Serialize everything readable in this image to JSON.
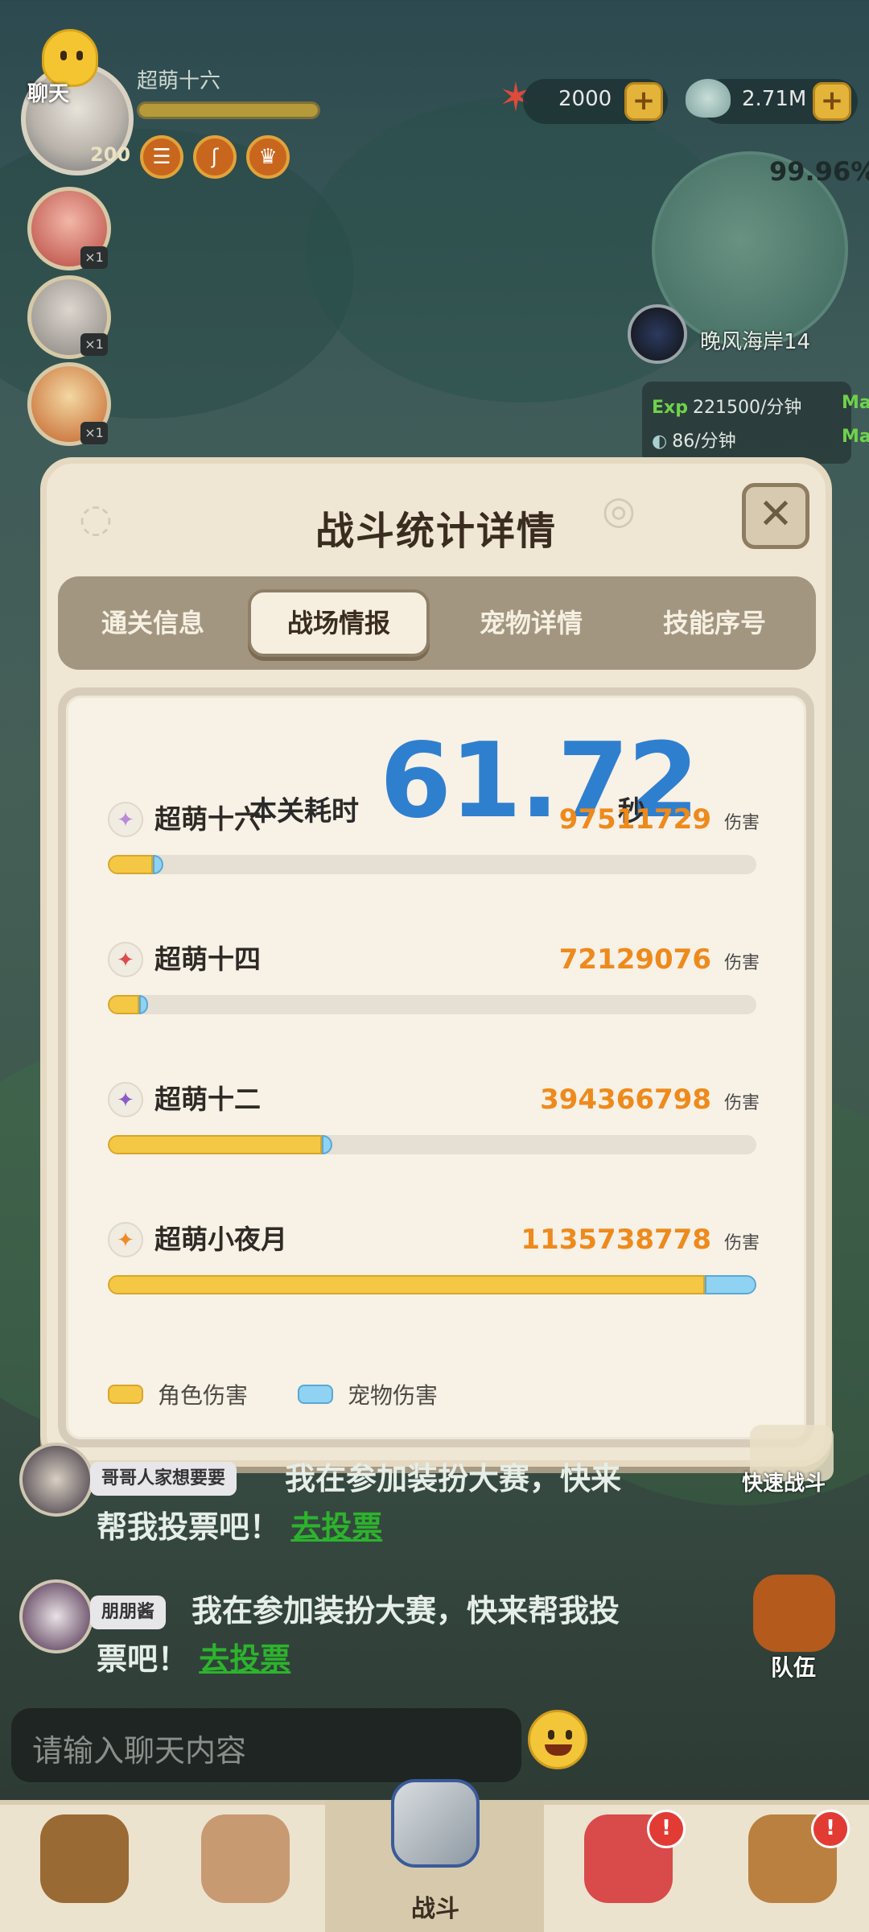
{
  "hud": {
    "chat_label": "聊天",
    "player_name": "超萌十六",
    "player_level": "200",
    "player_bar_fraction": 1.0,
    "buff_icons": [
      "hamburger-icon",
      "swirl-icon",
      "crown-icon"
    ],
    "currencies": [
      {
        "icon": "starfish-icon",
        "value": "2000"
      },
      {
        "icon": "shell-icon",
        "value": "2.71M"
      }
    ],
    "plus_label": "+",
    "progress_percent": "99.96%",
    "location_name": "晚风海岸14",
    "rates": {
      "exp_key": "Exp",
      "exp_value": "221500/分钟",
      "exp_max": "Max",
      "shell_value": "86/分钟",
      "shell_max": "Max"
    }
  },
  "dialog": {
    "title": "战斗统计详情",
    "close_label": "✕",
    "tabs": [
      {
        "label": "通关信息",
        "active": false
      },
      {
        "label": "战场情报",
        "active": true
      },
      {
        "label": "宠物详情",
        "active": false
      },
      {
        "label": "技能序号",
        "active": false
      }
    ],
    "time_label": "本关耗时",
    "time_value": "61.72",
    "time_unit": "秒",
    "damage_unit": "伤害",
    "entries": [
      {
        "name": "超萌十六",
        "damage": "97511729",
        "icon": "vortex-icon",
        "icon_color": "#b98ad8",
        "role_fraction": 0.07,
        "pet_fraction": 0.016
      },
      {
        "name": "超萌十四",
        "damage": "72129076",
        "icon": "crossed-swords-icon",
        "icon_color": "#e04a4a",
        "role_fraction": 0.048,
        "pet_fraction": 0.014
      },
      {
        "name": "超萌十二",
        "damage": "394366798",
        "icon": "crescent-swirl-icon",
        "icon_color": "#8b5cc8",
        "role_fraction": 0.33,
        "pet_fraction": 0.016
      },
      {
        "name": "超萌小夜月",
        "damage": "1135738778",
        "icon": "crossed-blades-icon",
        "icon_color": "#f08a24",
        "role_fraction": 0.92,
        "pet_fraction": 0.08
      }
    ],
    "legend": [
      {
        "label": "角色伤害",
        "color": "#f4c844"
      },
      {
        "label": "宠物伤害",
        "color": "#8fd2f2"
      }
    ]
  },
  "chat": {
    "messages": [
      {
        "sender": "哥哥人家想要要",
        "text_line1": "我在参加装扮大赛，快来",
        "text_line2": "帮我投票吧！",
        "link": "去投票"
      },
      {
        "sender": "朋朋酱",
        "text_line1": "我在参加装扮大赛，快来帮我投",
        "text_line2": "票吧！",
        "link": "去投票"
      }
    ],
    "input_placeholder": "请输入聊天内容"
  },
  "side_buttons": {
    "quick_battle": "快速战斗",
    "team": "队伍"
  },
  "bottom_nav": {
    "items": [
      {
        "icon": "caveman-icon",
        "label": ""
      },
      {
        "icon": "hero-icon",
        "label": ""
      },
      {
        "icon": "battle-axe-icon",
        "label": "战斗"
      },
      {
        "icon": "pet-icon",
        "label": "",
        "notification": "!"
      },
      {
        "icon": "totem-icon",
        "label": "",
        "notification": "!"
      }
    ]
  }
}
